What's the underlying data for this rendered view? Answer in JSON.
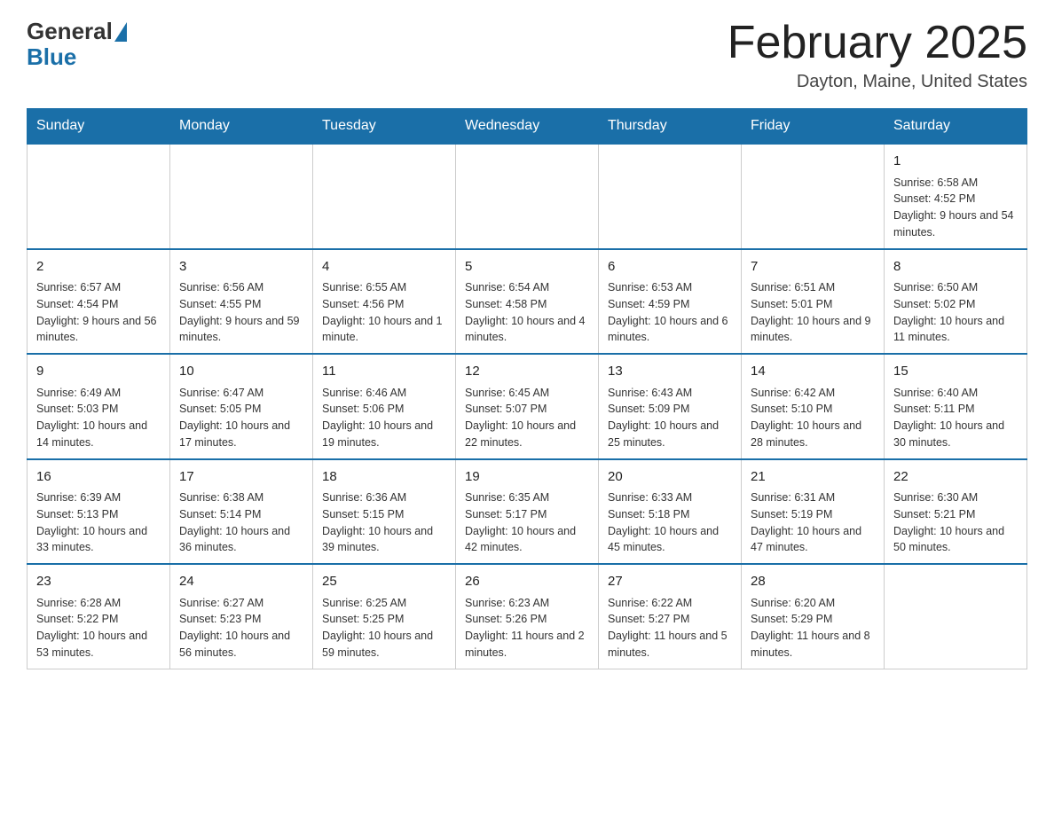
{
  "logo": {
    "general": "General",
    "blue": "Blue"
  },
  "header": {
    "title": "February 2025",
    "location": "Dayton, Maine, United States"
  },
  "days": {
    "headers": [
      "Sunday",
      "Monday",
      "Tuesday",
      "Wednesday",
      "Thursday",
      "Friday",
      "Saturday"
    ]
  },
  "weeks": [
    {
      "cells": [
        {
          "empty": true
        },
        {
          "empty": true
        },
        {
          "empty": true
        },
        {
          "empty": true
        },
        {
          "empty": true
        },
        {
          "empty": true
        },
        {
          "day": "1",
          "sunrise": "Sunrise: 6:58 AM",
          "sunset": "Sunset: 4:52 PM",
          "daylight": "Daylight: 9 hours and 54 minutes."
        }
      ]
    },
    {
      "cells": [
        {
          "day": "2",
          "sunrise": "Sunrise: 6:57 AM",
          "sunset": "Sunset: 4:54 PM",
          "daylight": "Daylight: 9 hours and 56 minutes."
        },
        {
          "day": "3",
          "sunrise": "Sunrise: 6:56 AM",
          "sunset": "Sunset: 4:55 PM",
          "daylight": "Daylight: 9 hours and 59 minutes."
        },
        {
          "day": "4",
          "sunrise": "Sunrise: 6:55 AM",
          "sunset": "Sunset: 4:56 PM",
          "daylight": "Daylight: 10 hours and 1 minute."
        },
        {
          "day": "5",
          "sunrise": "Sunrise: 6:54 AM",
          "sunset": "Sunset: 4:58 PM",
          "daylight": "Daylight: 10 hours and 4 minutes."
        },
        {
          "day": "6",
          "sunrise": "Sunrise: 6:53 AM",
          "sunset": "Sunset: 4:59 PM",
          "daylight": "Daylight: 10 hours and 6 minutes."
        },
        {
          "day": "7",
          "sunrise": "Sunrise: 6:51 AM",
          "sunset": "Sunset: 5:01 PM",
          "daylight": "Daylight: 10 hours and 9 minutes."
        },
        {
          "day": "8",
          "sunrise": "Sunrise: 6:50 AM",
          "sunset": "Sunset: 5:02 PM",
          "daylight": "Daylight: 10 hours and 11 minutes."
        }
      ]
    },
    {
      "cells": [
        {
          "day": "9",
          "sunrise": "Sunrise: 6:49 AM",
          "sunset": "Sunset: 5:03 PM",
          "daylight": "Daylight: 10 hours and 14 minutes."
        },
        {
          "day": "10",
          "sunrise": "Sunrise: 6:47 AM",
          "sunset": "Sunset: 5:05 PM",
          "daylight": "Daylight: 10 hours and 17 minutes."
        },
        {
          "day": "11",
          "sunrise": "Sunrise: 6:46 AM",
          "sunset": "Sunset: 5:06 PM",
          "daylight": "Daylight: 10 hours and 19 minutes."
        },
        {
          "day": "12",
          "sunrise": "Sunrise: 6:45 AM",
          "sunset": "Sunset: 5:07 PM",
          "daylight": "Daylight: 10 hours and 22 minutes."
        },
        {
          "day": "13",
          "sunrise": "Sunrise: 6:43 AM",
          "sunset": "Sunset: 5:09 PM",
          "daylight": "Daylight: 10 hours and 25 minutes."
        },
        {
          "day": "14",
          "sunrise": "Sunrise: 6:42 AM",
          "sunset": "Sunset: 5:10 PM",
          "daylight": "Daylight: 10 hours and 28 minutes."
        },
        {
          "day": "15",
          "sunrise": "Sunrise: 6:40 AM",
          "sunset": "Sunset: 5:11 PM",
          "daylight": "Daylight: 10 hours and 30 minutes."
        }
      ]
    },
    {
      "cells": [
        {
          "day": "16",
          "sunrise": "Sunrise: 6:39 AM",
          "sunset": "Sunset: 5:13 PM",
          "daylight": "Daylight: 10 hours and 33 minutes."
        },
        {
          "day": "17",
          "sunrise": "Sunrise: 6:38 AM",
          "sunset": "Sunset: 5:14 PM",
          "daylight": "Daylight: 10 hours and 36 minutes."
        },
        {
          "day": "18",
          "sunrise": "Sunrise: 6:36 AM",
          "sunset": "Sunset: 5:15 PM",
          "daylight": "Daylight: 10 hours and 39 minutes."
        },
        {
          "day": "19",
          "sunrise": "Sunrise: 6:35 AM",
          "sunset": "Sunset: 5:17 PM",
          "daylight": "Daylight: 10 hours and 42 minutes."
        },
        {
          "day": "20",
          "sunrise": "Sunrise: 6:33 AM",
          "sunset": "Sunset: 5:18 PM",
          "daylight": "Daylight: 10 hours and 45 minutes."
        },
        {
          "day": "21",
          "sunrise": "Sunrise: 6:31 AM",
          "sunset": "Sunset: 5:19 PM",
          "daylight": "Daylight: 10 hours and 47 minutes."
        },
        {
          "day": "22",
          "sunrise": "Sunrise: 6:30 AM",
          "sunset": "Sunset: 5:21 PM",
          "daylight": "Daylight: 10 hours and 50 minutes."
        }
      ]
    },
    {
      "cells": [
        {
          "day": "23",
          "sunrise": "Sunrise: 6:28 AM",
          "sunset": "Sunset: 5:22 PM",
          "daylight": "Daylight: 10 hours and 53 minutes."
        },
        {
          "day": "24",
          "sunrise": "Sunrise: 6:27 AM",
          "sunset": "Sunset: 5:23 PM",
          "daylight": "Daylight: 10 hours and 56 minutes."
        },
        {
          "day": "25",
          "sunrise": "Sunrise: 6:25 AM",
          "sunset": "Sunset: 5:25 PM",
          "daylight": "Daylight: 10 hours and 59 minutes."
        },
        {
          "day": "26",
          "sunrise": "Sunrise: 6:23 AM",
          "sunset": "Sunset: 5:26 PM",
          "daylight": "Daylight: 11 hours and 2 minutes."
        },
        {
          "day": "27",
          "sunrise": "Sunrise: 6:22 AM",
          "sunset": "Sunset: 5:27 PM",
          "daylight": "Daylight: 11 hours and 5 minutes."
        },
        {
          "day": "28",
          "sunrise": "Sunrise: 6:20 AM",
          "sunset": "Sunset: 5:29 PM",
          "daylight": "Daylight: 11 hours and 8 minutes."
        },
        {
          "empty": true
        }
      ]
    }
  ]
}
